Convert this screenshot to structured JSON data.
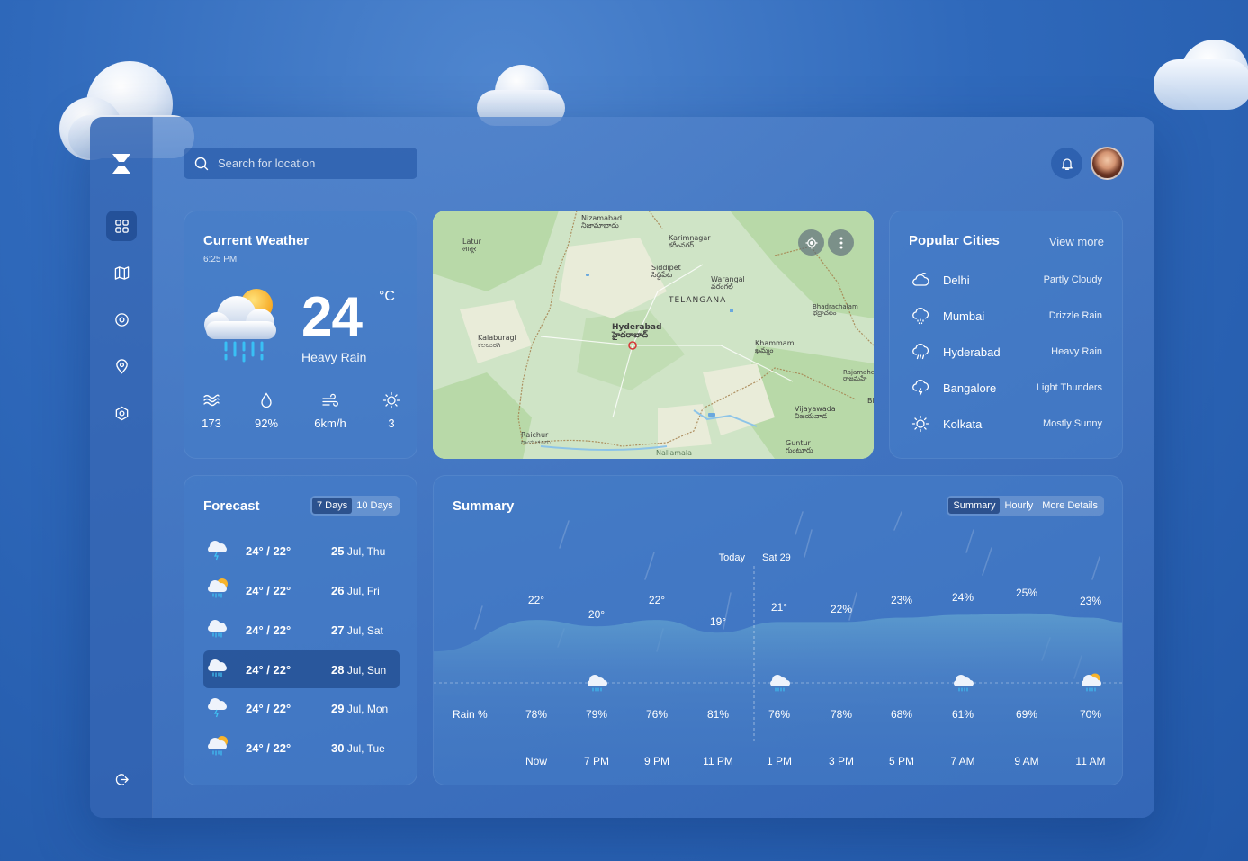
{
  "search": {
    "placeholder": "Search for location"
  },
  "current": {
    "title": "Current Weather",
    "time": "6:25 PM",
    "temp": "24",
    "unit": "°C",
    "condition": "Heavy Rain",
    "stats": [
      {
        "icon": "waves-icon",
        "value": "173"
      },
      {
        "icon": "droplet-icon",
        "value": "92%"
      },
      {
        "icon": "wind-icon",
        "value": "6km/h"
      },
      {
        "icon": "sun-icon",
        "value": "3"
      }
    ]
  },
  "map": {
    "labels": [
      {
        "text": "Nizamabad\nనిజామాబాదు"
      },
      {
        "text": "Karimnagar\nకరీంనగర్"
      },
      {
        "text": "Latur\nलातूर"
      },
      {
        "text": "Siddipet\nసిద్దిపేట"
      },
      {
        "text": "Warangal\nవరంగల్"
      },
      {
        "text": "TELANGANA"
      },
      {
        "text": "Bhadrachalam\nభద్రాచలం"
      },
      {
        "text": "Hyderabad\nహైదరాబాద్"
      },
      {
        "text": "Kalaburagi\nಕಲಬುರಗಿ"
      },
      {
        "text": "Khammam\nఖమ్మం"
      },
      {
        "text": "Rajamahe\nరాజమహే"
      },
      {
        "text": "Vijayawada\nవిజయవాడ"
      },
      {
        "text": "Raichur\nರಾಯಚೂರು"
      },
      {
        "text": "Guntur\nగుంటూరు"
      },
      {
        "text": "Nallamala"
      },
      {
        "text": "Bl"
      }
    ]
  },
  "cities": {
    "title": "Popular Cities",
    "view_more": "View more",
    "items": [
      {
        "name": "Delhi",
        "condition": "Partly Cloudy",
        "icon": "cloud-icon"
      },
      {
        "name": "Mumbai",
        "condition": "Drizzle Rain",
        "icon": "cloud-drizzle-icon"
      },
      {
        "name": "Hyderabad",
        "condition": "Heavy Rain",
        "icon": "cloud-rain-icon"
      },
      {
        "name": "Bangalore",
        "condition": "Light Thunders",
        "icon": "cloud-lightning-icon"
      },
      {
        "name": "Kolkata",
        "condition": "Mostly Sunny",
        "icon": "sun-icon"
      }
    ]
  },
  "forecast": {
    "title": "Forecast",
    "tabs": [
      "7 Days",
      "10 Days"
    ],
    "active_tab": "7 Days",
    "rows": [
      {
        "temp": "24° / 22°",
        "day": "25",
        "date": "Jul, Thu",
        "icon": "cloud-lightning-icon"
      },
      {
        "temp": "24° / 22°",
        "day": "26",
        "date": "Jul, Fri",
        "icon": "sun-cloud-rain-icon"
      },
      {
        "temp": "24° / 22°",
        "day": "27",
        "date": "Jul, Sat",
        "icon": "cloud-rain-icon"
      },
      {
        "temp": "24° / 22°",
        "day": "28",
        "date": "Jul, Sun",
        "icon": "cloud-rain-icon"
      },
      {
        "temp": "24° / 22°",
        "day": "29",
        "date": "Jul, Mon",
        "icon": "cloud-lightning-icon"
      },
      {
        "temp": "24° / 22°",
        "day": "30",
        "date": "Jul, Tue",
        "icon": "sun-cloud-rain-icon"
      }
    ]
  },
  "summary": {
    "title": "Summary",
    "tabs": [
      "Summary",
      "Hourly",
      "More Details"
    ],
    "active_tab": "Summary",
    "today_label": "Today",
    "next_day_label": "Sat 29",
    "rain_label": "Rain %",
    "top_values": [
      "22°",
      "20°",
      "22°",
      "19°",
      "21°",
      "22%",
      "23%",
      "24%",
      "25%",
      "23%"
    ],
    "rain": [
      "78%",
      "79%",
      "76%",
      "81%",
      "76%",
      "78%",
      "68%",
      "61%",
      "69%",
      "70%"
    ],
    "times": [
      "Now",
      "7 PM",
      "9 PM",
      "11 PM",
      "1 PM",
      "3 PM",
      "5 PM",
      "7 AM",
      "9 AM",
      "11 AM"
    ],
    "wave_levels": [
      0.62,
      0.4,
      0.62,
      0.18,
      0.55,
      0.55,
      0.7,
      0.8,
      0.85,
      0.7
    ],
    "icon_columns": [
      1,
      4,
      7,
      9
    ]
  }
}
